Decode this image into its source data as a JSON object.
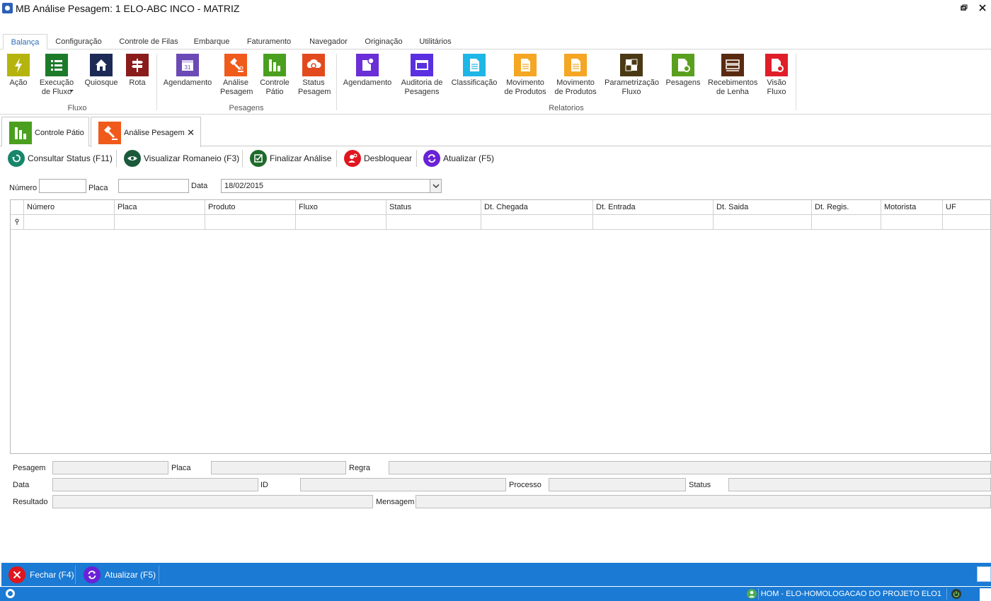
{
  "window": {
    "title": "MB Análise Pesagem: 1 ELO-ABC INCO - MATRIZ"
  },
  "ribbon_tabs": [
    "Balança",
    "Configuração",
    "Controle de Filas",
    "Embarque",
    "Faturamento",
    "Navegador",
    "Originação",
    "Utilitários"
  ],
  "ribbon": {
    "fluxo": {
      "label": "Fluxo",
      "buttons": [
        "Ação",
        "Execução de Fluxo",
        "Quiosque",
        "Rota"
      ]
    },
    "pesagens": {
      "label": "Pesagens",
      "buttons": [
        "Agendamento",
        "Análise Pesagem",
        "Controle Pátio",
        "Status Pesagem"
      ]
    },
    "relatorios": {
      "label": "Relatorios",
      "buttons": [
        "Agendamento",
        "Auditoria de Pesagens",
        "Classificação",
        "Movimento de Produtos",
        "Movimento de Produtos",
        "Parametrização Fluxo",
        "Pesagens",
        "Recebimentos de Lenha",
        "Visão Fluxo"
      ]
    }
  },
  "doc_tabs": [
    "Controle Pátio",
    "Análise Pesagem"
  ],
  "toolbar": [
    "Consultar Status (F11)",
    "Visualizar Romaneio (F3)",
    "Finalizar Análise",
    "Desbloquear",
    "Atualizar (F5)"
  ],
  "filter": {
    "numero_label": "Número",
    "placa_label": "Placa",
    "data_label": "Data",
    "data_value": "18/02/2015"
  },
  "grid": {
    "columns": [
      "Número",
      "Placa",
      "Produto",
      "Fluxo",
      "Status",
      "Dt. Chegada",
      "Dt. Entrada",
      "Dt. Saida",
      "Dt. Regis.",
      "Motorista",
      "UF"
    ]
  },
  "details": {
    "pesagem": "Pesagem",
    "placa": "Placa",
    "regra": "Regra",
    "data": "Data",
    "id": "ID",
    "processo": "Processo",
    "status": "Status",
    "resultado": "Resultado",
    "mensagem": "Mensagem"
  },
  "bottom": [
    "Fechar (F4)",
    "Atualizar (F5)"
  ],
  "statusbar": {
    "environment": "HOM - ELO-HOMOLOGACAO DO PROJETO ELO1"
  },
  "colors": {
    "accent": "#1a7ad4"
  }
}
